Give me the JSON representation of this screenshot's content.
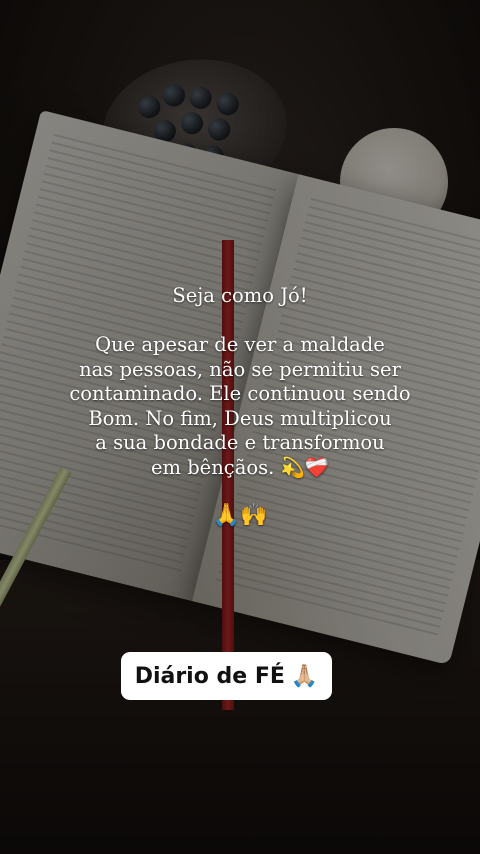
{
  "post": {
    "title": "Seja como Jó!",
    "body_lines": [
      "Que apesar de ver a maldade",
      "nas pessoas, não se permitiu ser",
      "contaminado. Ele continuou sendo",
      "Bom. No fim, Deus multiplicou",
      "a sua bondade e transformou",
      "em bênçãos. 💫❤️‍🩹"
    ],
    "emoji_row": "🙏🙌"
  },
  "badge": {
    "label": "Diário de FÉ",
    "emoji": "🙏🏼"
  }
}
